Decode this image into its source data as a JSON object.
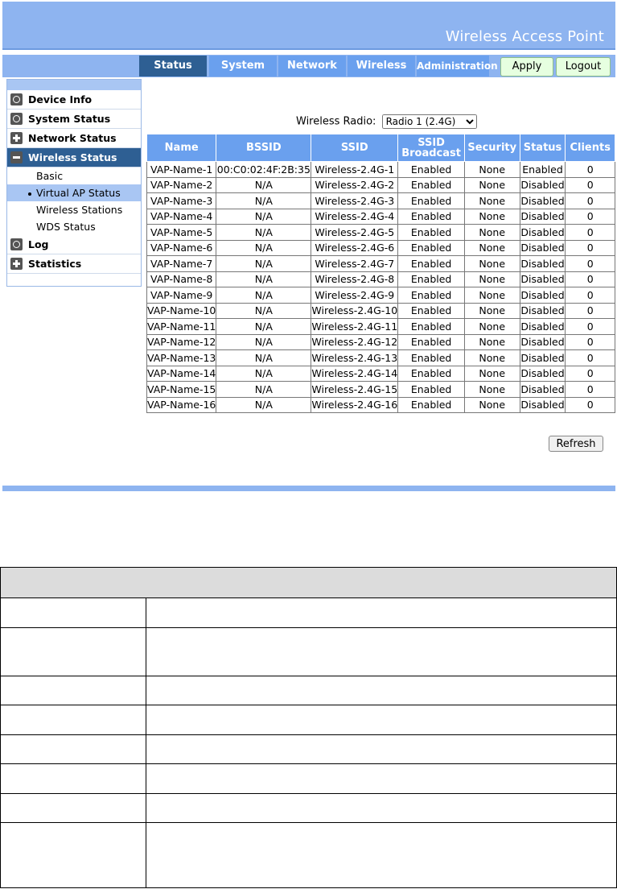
{
  "header": {
    "title": "Wireless Access Point"
  },
  "tabs": [
    {
      "label": "Status",
      "active": true
    },
    {
      "label": "System"
    },
    {
      "label": "Network"
    },
    {
      "label": "Wireless"
    },
    {
      "label": "Administration"
    }
  ],
  "actions": {
    "apply": "Apply",
    "logout": "Logout"
  },
  "sidebar": {
    "items": [
      {
        "label": "Device Info",
        "icon": "circle-icon"
      },
      {
        "label": "System Status",
        "icon": "circle-icon"
      },
      {
        "label": "Network Status",
        "icon": "plus-icon"
      },
      {
        "label": "Wireless Status",
        "icon": "minus-icon",
        "active": true
      }
    ],
    "subitems": [
      {
        "label": "Basic"
      },
      {
        "label": "Virtual AP Status",
        "active": true
      },
      {
        "label": "Wireless Stations"
      },
      {
        "label": "WDS Status"
      }
    ],
    "items2": [
      {
        "label": "Log",
        "icon": "circle-icon"
      },
      {
        "label": "Statistics",
        "icon": "plus-icon"
      }
    ]
  },
  "radio": {
    "label": "Wireless Radio:",
    "selected": "Radio 1 (2.4G)"
  },
  "table": {
    "columns": [
      "Name",
      "BSSID",
      "SSID",
      "SSID Broadcast",
      "Security",
      "Status",
      "Clients"
    ],
    "rows": [
      [
        "VAP-Name-1",
        "00:C0:02:4F:2B:35",
        "Wireless-2.4G-1",
        "Enabled",
        "None",
        "Enabled",
        "0"
      ],
      [
        "VAP-Name-2",
        "N/A",
        "Wireless-2.4G-2",
        "Enabled",
        "None",
        "Disabled",
        "0"
      ],
      [
        "VAP-Name-3",
        "N/A",
        "Wireless-2.4G-3",
        "Enabled",
        "None",
        "Disabled",
        "0"
      ],
      [
        "VAP-Name-4",
        "N/A",
        "Wireless-2.4G-4",
        "Enabled",
        "None",
        "Disabled",
        "0"
      ],
      [
        "VAP-Name-5",
        "N/A",
        "Wireless-2.4G-5",
        "Enabled",
        "None",
        "Disabled",
        "0"
      ],
      [
        "VAP-Name-6",
        "N/A",
        "Wireless-2.4G-6",
        "Enabled",
        "None",
        "Disabled",
        "0"
      ],
      [
        "VAP-Name-7",
        "N/A",
        "Wireless-2.4G-7",
        "Enabled",
        "None",
        "Disabled",
        "0"
      ],
      [
        "VAP-Name-8",
        "N/A",
        "Wireless-2.4G-8",
        "Enabled",
        "None",
        "Disabled",
        "0"
      ],
      [
        "VAP-Name-9",
        "N/A",
        "Wireless-2.4G-9",
        "Enabled",
        "None",
        "Disabled",
        "0"
      ],
      [
        "VAP-Name-10",
        "N/A",
        "Wireless-2.4G-10",
        "Enabled",
        "None",
        "Disabled",
        "0"
      ],
      [
        "VAP-Name-11",
        "N/A",
        "Wireless-2.4G-11",
        "Enabled",
        "None",
        "Disabled",
        "0"
      ],
      [
        "VAP-Name-12",
        "N/A",
        "Wireless-2.4G-12",
        "Enabled",
        "None",
        "Disabled",
        "0"
      ],
      [
        "VAP-Name-13",
        "N/A",
        "Wireless-2.4G-13",
        "Enabled",
        "None",
        "Disabled",
        "0"
      ],
      [
        "VAP-Name-14",
        "N/A",
        "Wireless-2.4G-14",
        "Enabled",
        "None",
        "Disabled",
        "0"
      ],
      [
        "VAP-Name-15",
        "N/A",
        "Wireless-2.4G-15",
        "Enabled",
        "None",
        "Disabled",
        "0"
      ],
      [
        "VAP-Name-16",
        "N/A",
        "Wireless-2.4G-16",
        "Enabled",
        "None",
        "Disabled",
        "0"
      ]
    ]
  },
  "refresh_label": "Refresh",
  "colors": {
    "header": "#8eb4f0",
    "tab": "#6aa0ee",
    "active": "#2e5f93"
  }
}
